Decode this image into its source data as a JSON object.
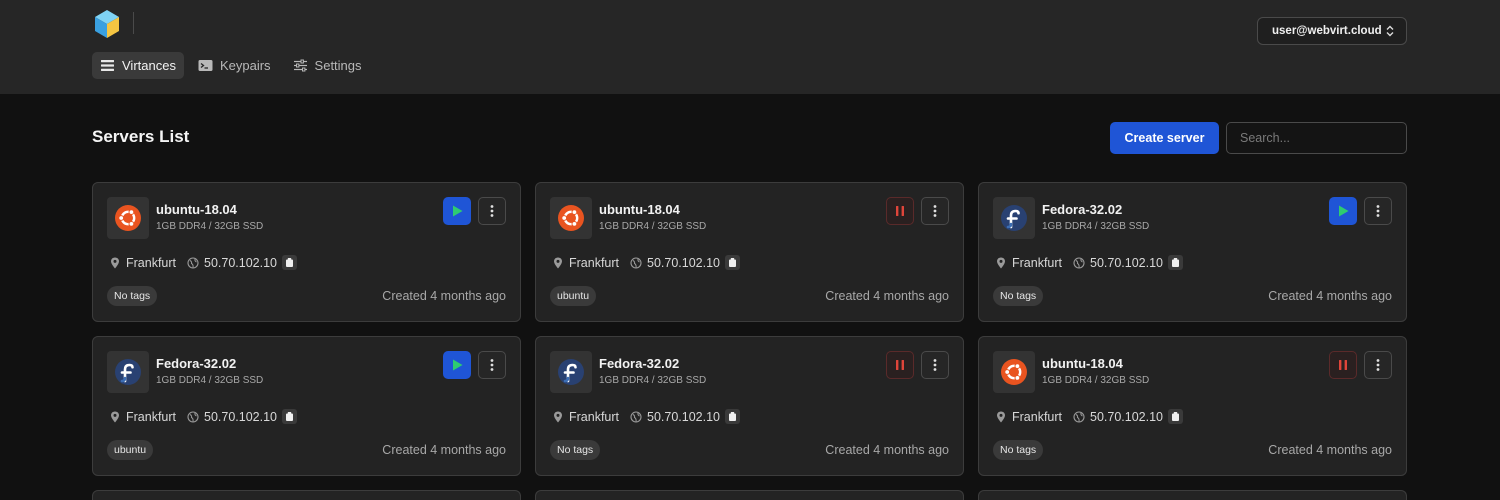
{
  "header": {
    "user_email": "user@webvirt.cloud",
    "nav": [
      {
        "label": "Virtances",
        "icon": "list-icon",
        "active": true
      },
      {
        "label": "Keypairs",
        "icon": "terminal-icon",
        "active": false
      },
      {
        "label": "Settings",
        "icon": "sliders-icon",
        "active": false
      }
    ]
  },
  "page": {
    "title": "Servers List",
    "create_label": "Create server",
    "search_placeholder": "Search..."
  },
  "colors": {
    "accent": "#1f55d6",
    "pause": "#e0453a",
    "play": "#2ecc71",
    "ubuntu": "#e95420",
    "fedora": "#294172"
  },
  "servers": [
    {
      "name": "ubuntu-18.04",
      "os": "ubuntu",
      "spec": "1GB DDR4 / 32GB SSD",
      "location": "Frankfurt",
      "ip": "50.70.102.10",
      "tag": "No tags",
      "created": "Created 4 months ago",
      "state": "play"
    },
    {
      "name": "ubuntu-18.04",
      "os": "ubuntu",
      "spec": "1GB DDR4 / 32GB SSD",
      "location": "Frankfurt",
      "ip": "50.70.102.10",
      "tag": "ubuntu",
      "created": "Created 4 months ago",
      "state": "pause"
    },
    {
      "name": "Fedora-32.02",
      "os": "fedora",
      "spec": "1GB DDR4 / 32GB SSD",
      "location": "Frankfurt",
      "ip": "50.70.102.10",
      "tag": "No tags",
      "created": "Created 4 months ago",
      "state": "play"
    },
    {
      "name": "Fedora-32.02",
      "os": "fedora",
      "spec": "1GB DDR4 / 32GB SSD",
      "location": "Frankfurt",
      "ip": "50.70.102.10",
      "tag": "ubuntu",
      "created": "Created 4 months ago",
      "state": "play"
    },
    {
      "name": "Fedora-32.02",
      "os": "fedora",
      "spec": "1GB DDR4 / 32GB SSD",
      "location": "Frankfurt",
      "ip": "50.70.102.10",
      "tag": "No tags",
      "created": "Created 4 months ago",
      "state": "pause"
    },
    {
      "name": "ubuntu-18.04",
      "os": "ubuntu",
      "spec": "1GB DDR4 / 32GB SSD",
      "location": "Frankfurt",
      "ip": "50.70.102.10",
      "tag": "No tags",
      "created": "Created 4 months ago",
      "state": "pause"
    }
  ]
}
